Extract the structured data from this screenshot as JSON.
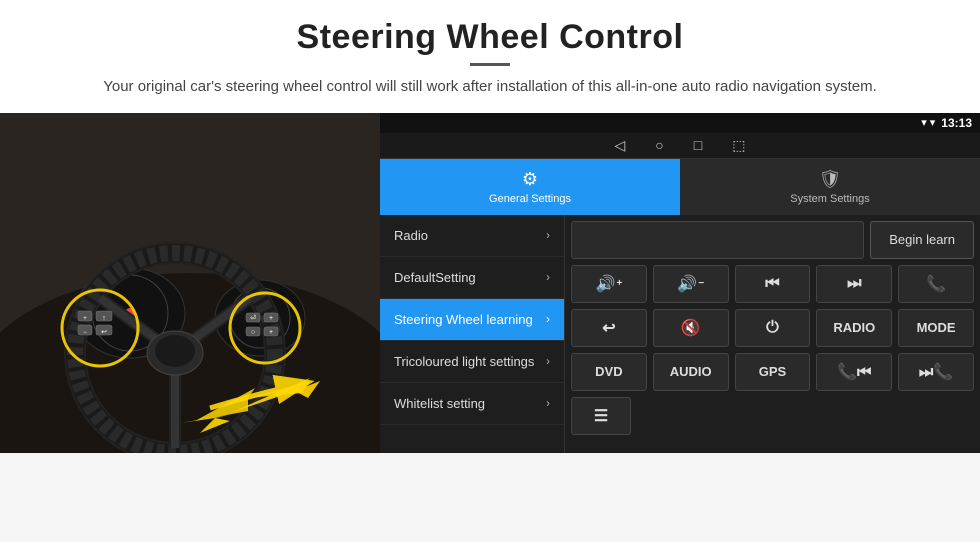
{
  "header": {
    "title": "Steering Wheel Control",
    "divider": "—",
    "subtitle": "Your original car's steering wheel control will still work after installation of this all-in-one auto radio navigation system."
  },
  "status_bar": {
    "time": "13:13",
    "icons": "▾ ▾"
  },
  "nav_bar": {
    "back": "◁",
    "home": "○",
    "recent": "□",
    "cast": "⬚"
  },
  "tabs": [
    {
      "id": "general",
      "icon": "⚙",
      "label": "General Settings",
      "active": true
    },
    {
      "id": "system",
      "icon": "🛡",
      "label": "System Settings",
      "active": false
    }
  ],
  "menu_items": [
    {
      "id": "radio",
      "label": "Radio",
      "active": false
    },
    {
      "id": "default",
      "label": "DefaultSetting",
      "active": false
    },
    {
      "id": "steering",
      "label": "Steering Wheel learning",
      "active": true
    },
    {
      "id": "tricolour",
      "label": "Tricoloured light settings",
      "active": false
    },
    {
      "id": "whitelist",
      "label": "Whitelist setting",
      "active": false
    }
  ],
  "right_panel": {
    "begin_learn_label": "Begin learn",
    "rows": [
      [
        "🔊+",
        "🔊−",
        "⏮",
        "⏭",
        "📞"
      ],
      [
        "↩",
        "🔊✕",
        "⏻",
        "RADIO",
        "MODE"
      ],
      [
        "DVD",
        "AUDIO",
        "GPS",
        "📞⏮",
        "⏭📞"
      ],
      [
        "⬚"
      ]
    ]
  }
}
